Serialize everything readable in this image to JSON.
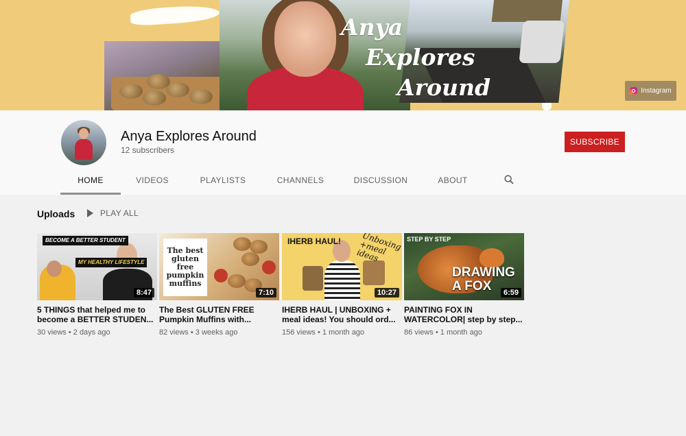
{
  "banner": {
    "title_lines": [
      "Anya",
      "Explores",
      "Around"
    ],
    "instagram_label": "Instagram"
  },
  "channel": {
    "name": "Anya Explores Around",
    "subscribers": "12 subscribers",
    "subscribe_label": "SUBSCRIBE"
  },
  "tabs": [
    {
      "label": "HOME",
      "active": true
    },
    {
      "label": "VIDEOS",
      "active": false
    },
    {
      "label": "PLAYLISTS",
      "active": false
    },
    {
      "label": "CHANNELS",
      "active": false
    },
    {
      "label": "DISCUSSION",
      "active": false
    },
    {
      "label": "ABOUT",
      "active": false
    }
  ],
  "uploads": {
    "title": "Uploads",
    "play_all_label": "PLAY ALL"
  },
  "videos": [
    {
      "title": "5 THINGS that helped me to become a BETTER STUDEN...",
      "duration": "8:47",
      "views": "30 views",
      "age": "2 days ago",
      "thumb_text": [
        "BECOME A BETTER STUDENT",
        "MY HEALTHY LIFESTYLE"
      ]
    },
    {
      "title": "The Best GLUTEN FREE Pumpkin Muffins with...",
      "duration": "7:10",
      "views": "82 views",
      "age": "3 weeks ago",
      "thumb_text": [
        "The best gluten free pumpkin muffins"
      ]
    },
    {
      "title": "IHERB HAUL | UNBOXING + meal ideas! You should ord...",
      "duration": "10:27",
      "views": "156 views",
      "age": "1 month ago",
      "thumb_text": [
        "IHERB HAUL!",
        "Unboxing +meal ideas"
      ]
    },
    {
      "title": "PAINTING FOX IN WATERCOLOR| step by step...",
      "duration": "6:59",
      "views": "86 views",
      "age": "1 month ago",
      "thumb_text": [
        "STEP BY STEP",
        "DRAWING A FOX"
      ]
    }
  ],
  "icons": {
    "search": "search-icon",
    "play": "play-icon",
    "instagram": "instagram-icon"
  },
  "colors": {
    "banner_bg": "#f0cc7a",
    "subscribe_bg": "#cc1f1f",
    "page_bg": "#f1f1f1"
  }
}
